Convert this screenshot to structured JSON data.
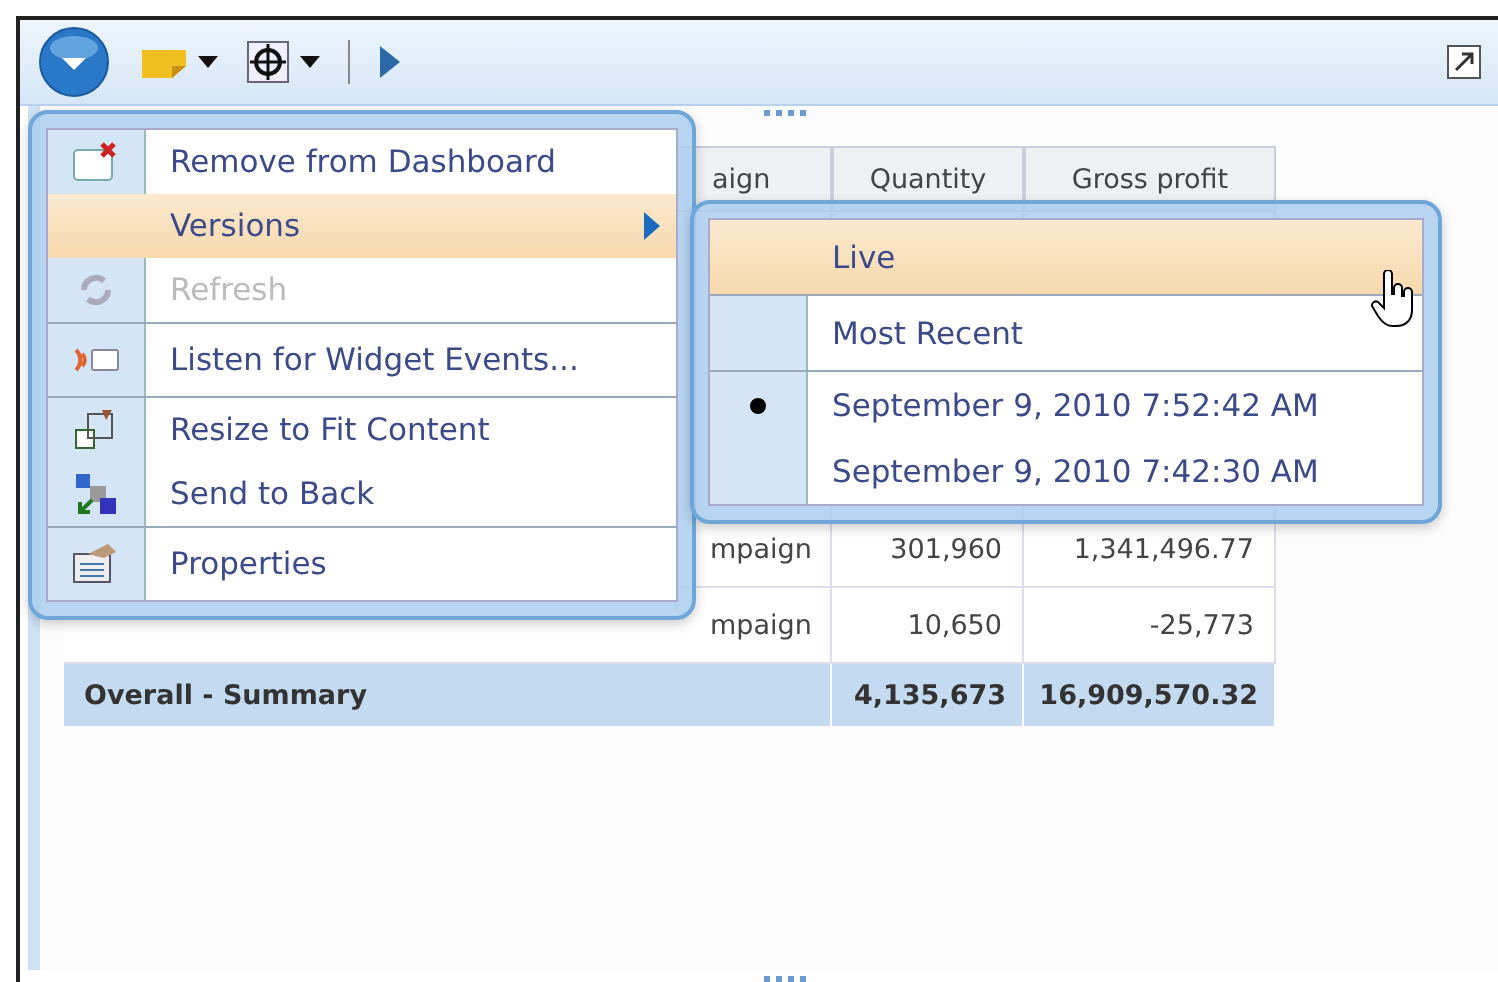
{
  "toolbar": {
    "buttons": [
      {
        "kind": "menu"
      },
      {
        "kind": "note"
      },
      {
        "kind": "target"
      },
      {
        "kind": "play"
      }
    ]
  },
  "table": {
    "columns": [
      "aign",
      "Quantity",
      "Gross profit"
    ],
    "rows": [
      {
        "cells": [
          "mpaign",
          "301,960",
          "1,341,496.77"
        ]
      },
      {
        "cells": [
          "mpaign",
          "10,650",
          "-25,773"
        ]
      }
    ],
    "summary": {
      "label": "Overall - Summary",
      "quantity": "4,135,673",
      "profit": "16,909,570.32"
    }
  },
  "context_menu": {
    "items": [
      {
        "kind": "remove",
        "label": "Remove from Dashboard",
        "disabled": false,
        "selected": false,
        "submenu": false,
        "separator_before": false
      },
      {
        "kind": "versions",
        "label": "Versions",
        "disabled": false,
        "selected": true,
        "submenu": true,
        "separator_before": false
      },
      {
        "kind": "refresh",
        "label": "Refresh",
        "disabled": true,
        "selected": false,
        "submenu": false,
        "separator_before": false
      },
      {
        "kind": "listen",
        "label": "Listen for Widget Events...",
        "disabled": false,
        "selected": false,
        "submenu": false,
        "separator_before": true
      },
      {
        "kind": "resize",
        "label": "Resize to Fit Content",
        "disabled": false,
        "selected": false,
        "submenu": false,
        "separator_before": true
      },
      {
        "kind": "back",
        "label": "Send to Back",
        "disabled": false,
        "selected": false,
        "submenu": false,
        "separator_before": false
      },
      {
        "kind": "properties",
        "label": "Properties",
        "disabled": false,
        "selected": false,
        "submenu": false,
        "separator_before": true
      }
    ]
  },
  "versions_menu": {
    "items": [
      {
        "label": "Live",
        "selected": true,
        "checked": false,
        "separator_before": false
      },
      {
        "label": "Most Recent",
        "selected": false,
        "checked": false,
        "separator_before": true
      },
      {
        "label": "September 9, 2010 7:52:42 AM",
        "selected": false,
        "checked": true,
        "separator_before": true
      },
      {
        "label": "September 9, 2010 7:42:30 AM",
        "selected": false,
        "checked": false,
        "separator_before": false
      }
    ]
  }
}
